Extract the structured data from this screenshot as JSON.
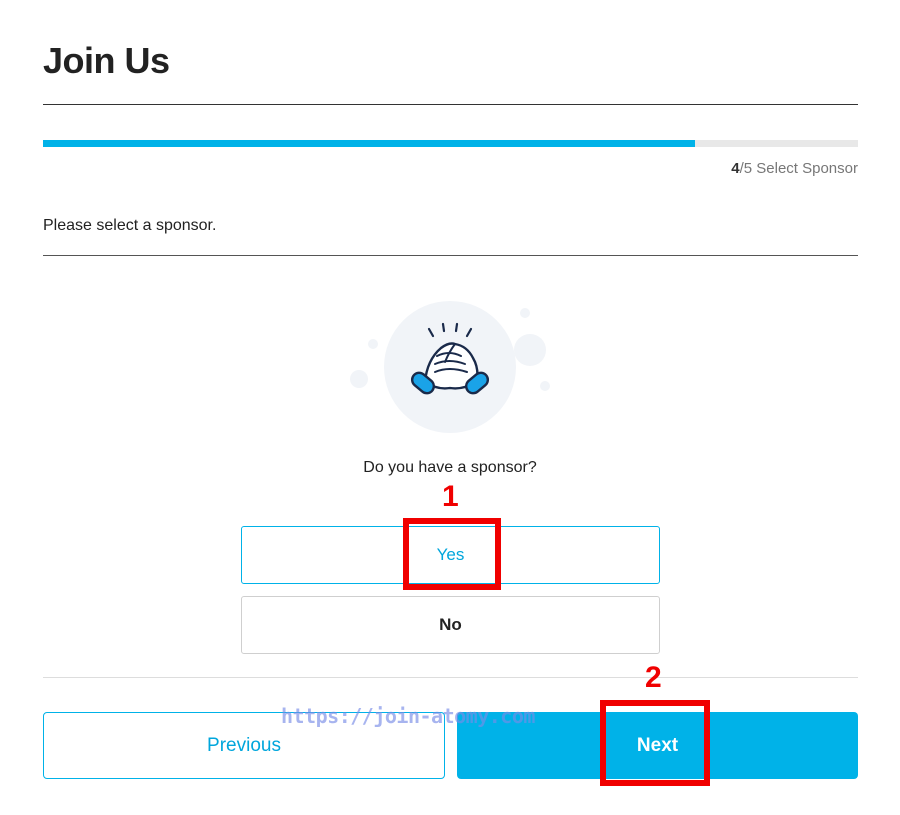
{
  "page": {
    "title": "Join Us"
  },
  "progress": {
    "fraction": 0.8,
    "step_current": "4",
    "step_total": "/5",
    "step_label": " Select Sponsor"
  },
  "prompt": "Please select a sponsor.",
  "illustration": {
    "icon": "handshake-icon"
  },
  "question": "Do you have a sponsor?",
  "options": {
    "yes_label": "Yes",
    "no_label": "No"
  },
  "nav": {
    "previous_label": "Previous",
    "next_label": "Next"
  },
  "watermark": "https://join-atomy.com",
  "annotations": {
    "first": "1",
    "second": "2"
  },
  "colors": {
    "accent": "#00b2e8",
    "annotation": "#f00000",
    "text": "#222222"
  }
}
